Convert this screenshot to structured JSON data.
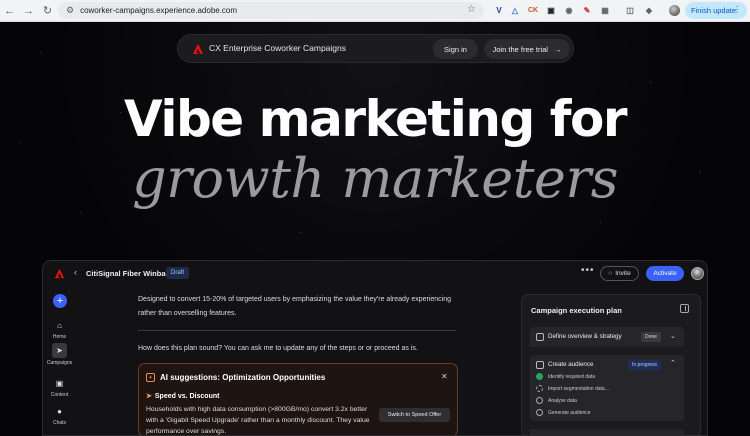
{
  "browser": {
    "url": "coworker-campaigns.experience.adobe.com",
    "finish_update": "Finish update"
  },
  "topnav": {
    "brand": "CX Enterprise Coworker Campaigns",
    "sign_in": "Sign in",
    "free_trial": "Join the free trial"
  },
  "hero": {
    "line1": "Vibe marketing for",
    "line2": "growth marketers"
  },
  "app": {
    "campaign_title": "CitiSignal Fiber Winback",
    "status_badge": "Draft",
    "invite": "Invite",
    "activate": "Activate",
    "rail": [
      {
        "label": "Home"
      },
      {
        "label": "Campaigns"
      },
      {
        "label": "Content"
      },
      {
        "label": "Chats"
      }
    ],
    "chat": {
      "message1": "Designed to convert 15-20% of targeted users by emphasizing the value they're already experiencing rather than overselling features.",
      "message2": "How does this plan sound? You can ask me to update any of the steps or or proceed as is."
    },
    "ai_card": {
      "title": "AI suggestions: Optimization Opportunities",
      "suggestion_title": "Speed vs. Discount",
      "suggestion_body": "Households with high data consumption (>800GB/mo) convert 3.2x better with a 'Gigabit Speed Upgrade' rather than a monthly discount. They value performance over savings.",
      "action": "Switch to Speed Offer"
    },
    "plan": {
      "title": "Campaign execution plan",
      "steps": [
        {
          "label": "Define overview & strategy",
          "badge": "Done"
        },
        {
          "label": "Create audience",
          "badge": "In progress"
        }
      ],
      "substeps": [
        {
          "label": "Identify required data",
          "state": "done"
        },
        {
          "label": "Import segmentation data...",
          "state": "active"
        },
        {
          "label": "Analyse data",
          "state": "pending"
        },
        {
          "label": "Generate audience",
          "state": "pending"
        }
      ]
    }
  }
}
